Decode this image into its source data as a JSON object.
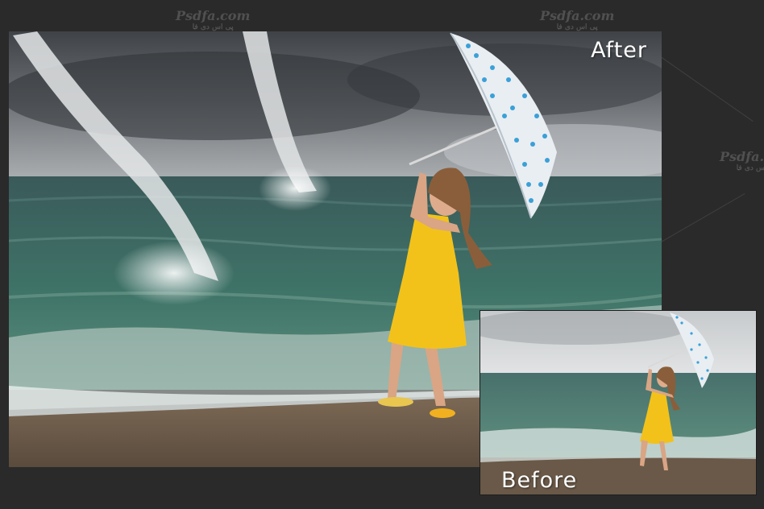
{
  "labels": {
    "after": "After",
    "before": "Before"
  },
  "watermark": {
    "brand": "Psdfa.com",
    "sub": "پی اس دی فا"
  },
  "colors": {
    "background": "#2a2a2a",
    "dress": "#f2c21b",
    "sea": "#3d6f69",
    "sky_storm": "#5a5e63",
    "sky_calm": "#d7dadb",
    "sand": "#6b5a48",
    "umbrella_dots": "#3aa0d8"
  }
}
